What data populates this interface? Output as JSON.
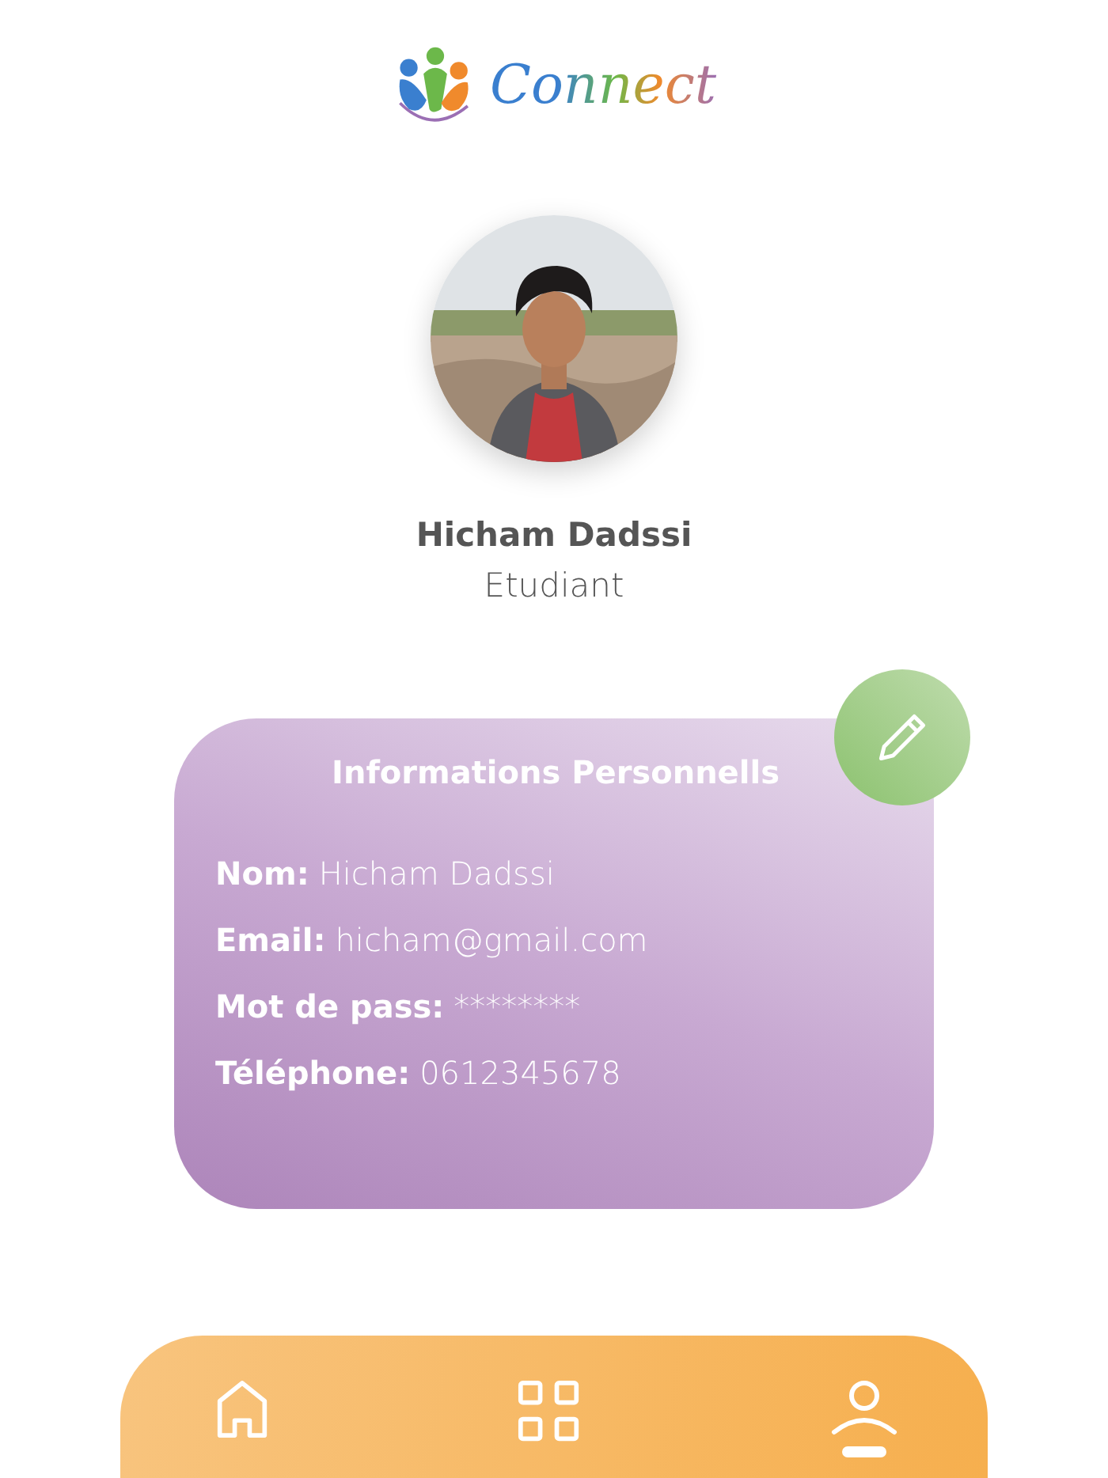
{
  "logo": {
    "text": "Connect"
  },
  "profile": {
    "name": "Hicham Dadssi",
    "role": "Etudiant"
  },
  "info_card": {
    "title": "Informations Personnells",
    "fields": [
      {
        "label": "Nom:",
        "value": "Hicham Dadssi"
      },
      {
        "label": "Email:",
        "value": "hicham@gmail.com"
      },
      {
        "label": "Mot de pass:",
        "value": "********"
      },
      {
        "label": "Téléphone:",
        "value": "0612345678"
      }
    ]
  },
  "bottom_nav": [
    {
      "kind": "home",
      "selected": false
    },
    {
      "kind": "grid",
      "selected": false
    },
    {
      "kind": "profile",
      "selected": true
    }
  ]
}
